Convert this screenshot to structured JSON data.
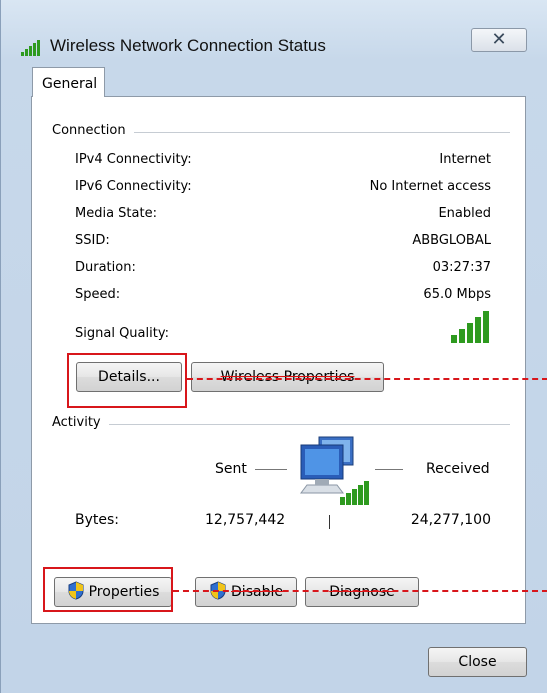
{
  "window": {
    "title": "Wireless Network Connection Status",
    "close_glyph": "✕"
  },
  "tabs": [
    {
      "label": "General"
    }
  ],
  "connection": {
    "group_label": "Connection",
    "rows": [
      {
        "label": "IPv4 Connectivity:",
        "value": "Internet"
      },
      {
        "label": "IPv6 Connectivity:",
        "value": "No Internet access"
      },
      {
        "label": "Media State:",
        "value": "Enabled"
      },
      {
        "label": "SSID:",
        "value": "ABBGLOBAL"
      },
      {
        "label": "Duration:",
        "value": "03:27:37"
      },
      {
        "label": "Speed:",
        "value": "65.0 Mbps"
      }
    ],
    "signal_quality_label": "Signal Quality:",
    "signal_bars": 5,
    "details_button": "Details...",
    "wireless_properties_button": "Wireless Properties"
  },
  "activity": {
    "group_label": "Activity",
    "sent_label": "Sent",
    "received_label": "Received",
    "bytes_label": "Bytes:",
    "bytes_sent": "12,757,442",
    "bytes_received": "24,277,100"
  },
  "actions": {
    "properties_button": "Properties",
    "disable_button": "Disable",
    "diagnose_button": "Diagnose"
  },
  "footer": {
    "close_button": "Close"
  },
  "colors": {
    "accent_red": "#d8161b",
    "signal_green": "#2e9a1f"
  }
}
